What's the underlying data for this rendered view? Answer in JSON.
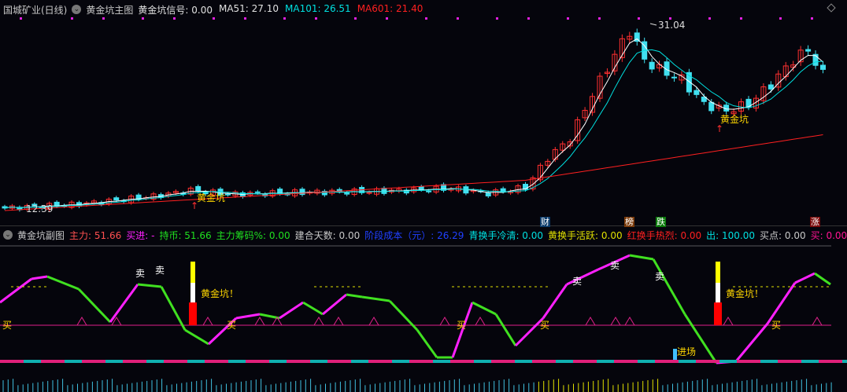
{
  "main_header": {
    "stock": "国城矿业(日线)",
    "indicator": "黄金坑主图",
    "items": [
      {
        "label": "黄金坑信号: 0.00",
        "color": "#e0e0e0"
      },
      {
        "label": "MA51: 27.10",
        "color": "#e0e0e0"
      },
      {
        "label": "MA101: 26.51",
        "color": "#00e0e0"
      },
      {
        "label": "MA601: 21.40",
        "color": "#ff2020"
      }
    ]
  },
  "sub_header": {
    "indicator": "黄金坑副图",
    "items": [
      {
        "label": "主力: 51.66",
        "color": "#ff5050"
      },
      {
        "label": "买进: -",
        "color": "#ff20ff"
      },
      {
        "label": "持币: 51.66",
        "color": "#20e020"
      },
      {
        "label": "主力筹码%: 0.00",
        "color": "#20e020"
      },
      {
        "label": "建合天数: 0.00",
        "color": "#c8c8c8"
      },
      {
        "label": "阶段成本（元）: 26.29",
        "color": "#2040ff"
      },
      {
        "label": "青换手冷清: 0.00",
        "color": "#00e0e0"
      },
      {
        "label": "黄换手活跃: 0.00",
        "color": "#e0e000"
      },
      {
        "label": "红换手热烈: 0.00",
        "color": "#ff2020"
      },
      {
        "label": "出: 100.00",
        "color": "#00e0e0"
      },
      {
        "label": "买点: 0.00",
        "color": "#c8c8c8"
      },
      {
        "label": "买: 0.00",
        "color": "#ff1493"
      }
    ]
  },
  "annotations": {
    "high_price": "31.04",
    "low_price": "12.39",
    "golden_pit": "黄金坑",
    "golden_pit_excl": "黄金坑！",
    "buy": "买",
    "sell": "卖",
    "enter": "进场"
  },
  "tags": [
    {
      "text": "财",
      "color": "#0a3a6a"
    },
    {
      "text": "榜",
      "color": "#7a3a0a"
    },
    {
      "text": "跌",
      "color": "#0a7a0a"
    },
    {
      "text": "涨",
      "color": "#7a0a0a"
    }
  ],
  "chart_data": {
    "type": "candlestick",
    "price_keypoints": [
      [
        0,
        12.4
      ],
      [
        10,
        12.8
      ],
      [
        20,
        13.6
      ],
      [
        25,
        14.2
      ],
      [
        30,
        13.8
      ],
      [
        40,
        14.0
      ],
      [
        50,
        14.1
      ],
      [
        60,
        14.4
      ],
      [
        65,
        13.9
      ],
      [
        70,
        14.5
      ],
      [
        73,
        17.5
      ],
      [
        76,
        19.5
      ],
      [
        79,
        24
      ],
      [
        82,
        28
      ],
      [
        84,
        30.5
      ],
      [
        86,
        27.5
      ],
      [
        88,
        26.5
      ],
      [
        91,
        25.5
      ],
      [
        94,
        23
      ],
      [
        97,
        22.3
      ],
      [
        100,
        23
      ],
      [
        103,
        25
      ],
      [
        106,
        27.5
      ],
      [
        108,
        28.5
      ],
      [
        110,
        26
      ]
    ],
    "ma_colors": {
      "ma51": "#ffffff",
      "ma101": "#00e0e0",
      "ma601": "#ff2020"
    },
    "up_color": "#ff3030",
    "down_color": "#40e0f0"
  }
}
